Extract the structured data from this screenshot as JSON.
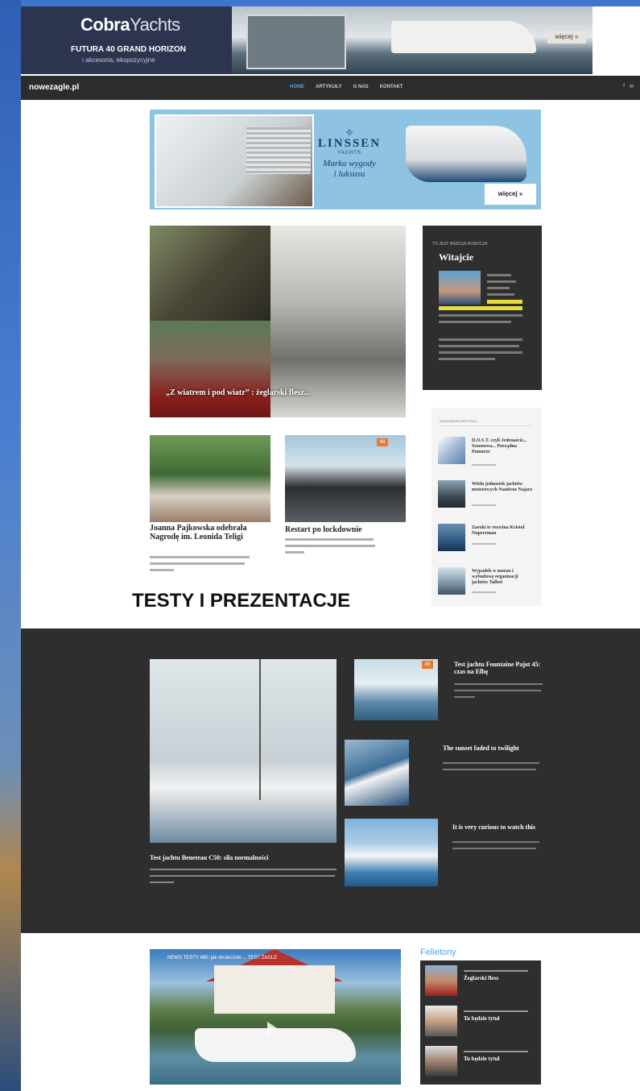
{
  "banner": {
    "logo_bold": "Cobra",
    "logo_light": "Yachts",
    "headline": "FUTURA 40 GRAND HORIZON",
    "subline": "i akcesoria, ekspozycyjne",
    "more_label": "więcej »"
  },
  "nav": {
    "brand": "nowezagle.pl",
    "items": [
      {
        "label": "HOME",
        "active": true
      },
      {
        "label": "ARTYKUŁY",
        "active": false
      },
      {
        "label": "O NAS",
        "active": false
      },
      {
        "label": "KONTAKT",
        "active": false
      }
    ],
    "social": [
      "f",
      "✉"
    ]
  },
  "ad2": {
    "mark": "⟡",
    "brand": "LINSSEN",
    "brand_sub": "YACHTS",
    "tagline_1": "Marka wygody",
    "tagline_2": "i luksusu",
    "more_label": "więcej »"
  },
  "hero": {
    "caption": "„Z wiatrem i pod wiatr” : żeglarski flesz..."
  },
  "welcome": {
    "kicker": "To jest wersja robocza",
    "title": "Witajcie"
  },
  "sidelist": {
    "head": "Najnowsze artykuły",
    "items": [
      {
        "title": "D.O.S.T. czyli Jedenaście... Sezonowa... Porządna Pomorze"
      },
      {
        "title": "Wielu jednostek jachtów motorowych Nauticus Najarz"
      },
      {
        "title": "Zaroki te rozwina Kristof Nuperrman"
      },
      {
        "title": "Wypadek w morzu i wybudowę organizacji jachtów Talbot"
      }
    ]
  },
  "articles": [
    {
      "title": "Joanna Pajkowska odebrała Nagrodę im. Leonida Teligi"
    },
    {
      "title": "Restart po lockdownie",
      "badge": "48"
    }
  ],
  "section_title": "TESTY I PREZENTACJE",
  "dark": {
    "main_title": "Test jachtu Beneteau C50: siła normalności",
    "tiles": [
      {
        "title": "Test jachtu Fountaine Pajot 45: czas na Elbę",
        "badge": "48"
      },
      {
        "title": "The sunset faded to twilight"
      },
      {
        "title": "It is very curious to watch this"
      }
    ]
  },
  "video": {
    "title": "NEWS TESTY 480: jak skutecznie ... TEST ŻAGLE"
  },
  "felietony": {
    "title": "Felietony",
    "items": [
      {
        "title": "Żeglarski flesz"
      },
      {
        "title": "Tu będzie tytuł"
      },
      {
        "title": "Tu będzie tytuł"
      }
    ]
  },
  "colors": {
    "accent": "#4fa3e6",
    "dark_bg": "#2e2e2e",
    "badge": "#e67a2e",
    "highlight": "#e8dc3a"
  }
}
